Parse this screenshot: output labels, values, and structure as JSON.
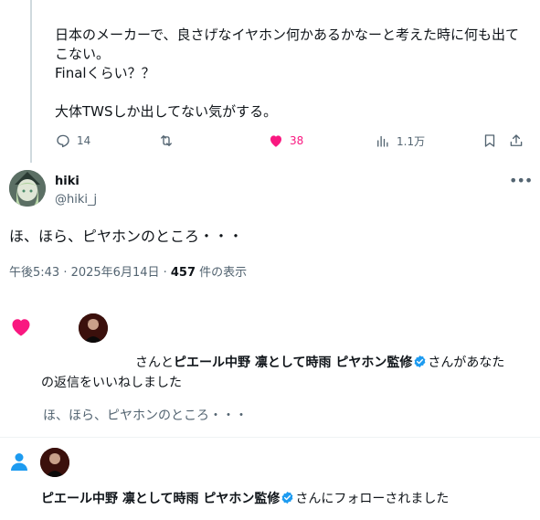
{
  "parent_tweet": {
    "text": "日本のメーカーで、良さげなイヤホン何かあるかなーと考えた時に何も出てこない。\nFinalくらい？？\n\n大体TWSしか出してない気がする。",
    "replies": "14",
    "likes": "38",
    "views": "1.1万"
  },
  "reply_tweet": {
    "author_name": "hiki",
    "author_handle": "@hiki_j",
    "text": "ほ、ほら、ピヤホンのところ・・・",
    "time": "午後5:43 · 2025年6月14日 · ",
    "views_count": "457",
    "views_suffix": " 件の表示"
  },
  "notification_like": {
    "prefix": "さんと",
    "user_name": "ピエール中野 凛として時雨 ピヤホン監修",
    "suffix": "さんがあなたの返信をいいねしました",
    "quoted_text": "ほ、ほら、ピヤホンのところ・・・"
  },
  "notification_follow": {
    "user_name": "ピエール中野 凛として時雨 ピヤホン監修",
    "suffix": "さんにフォローされました"
  },
  "colors": {
    "like_pink": "#f91880",
    "verified_blue": "#1d9bf0",
    "follow_blue": "#1d9bf0",
    "muted_gray": "#536471"
  },
  "icons": [
    "reply-icon",
    "retweet-icon",
    "heart-icon",
    "views-icon",
    "bookmark-icon",
    "share-icon",
    "more-icon",
    "verified-badge-icon",
    "person-icon"
  ]
}
